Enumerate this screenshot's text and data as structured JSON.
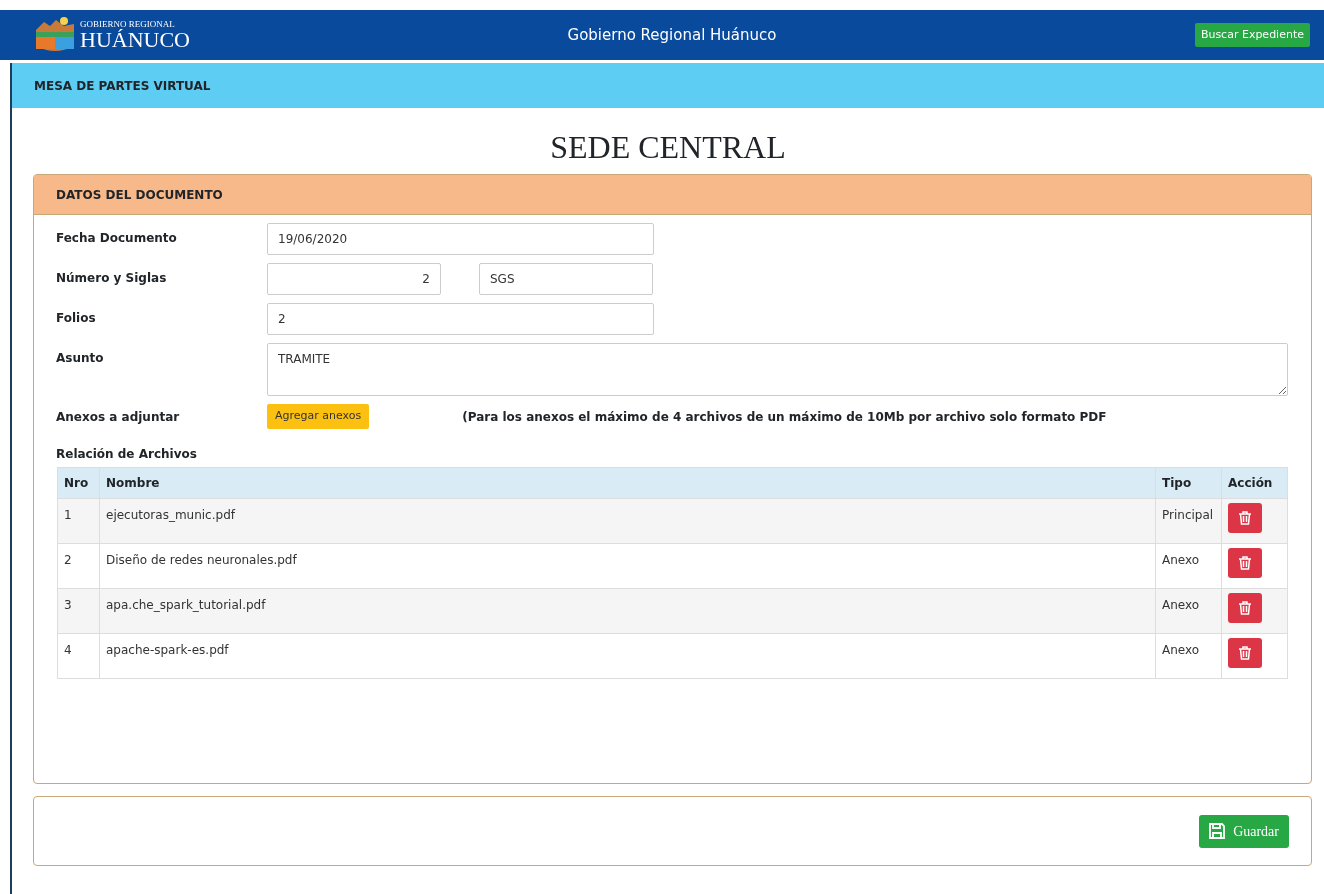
{
  "header": {
    "logo_top": "GOBIERNO REGIONAL",
    "logo_bottom": "HUÁNUCO",
    "title": "Gobierno Regional Huánuco",
    "search_button": "Buscar Expediente"
  },
  "subheader": {
    "title": "MESA DE PARTES VIRTUAL"
  },
  "heading": "SEDE CENTRAL",
  "document_card": {
    "title": "DATOS DEL DOCUMENTO",
    "fields": [
      {
        "label": "Fecha Documento",
        "kind": "text",
        "values": [
          "19/06/2020"
        ]
      },
      {
        "label": "Número y Siglas",
        "kind": "pair",
        "values": [
          "2",
          "SGS"
        ]
      },
      {
        "label": "Folios",
        "kind": "text",
        "values": [
          "2"
        ]
      },
      {
        "label": "Asunto",
        "kind": "textarea",
        "values": [
          "TRAMITE"
        ]
      }
    ],
    "annexes": {
      "label": "Anexos a adjuntar",
      "button": "Agregar anexos",
      "note": "(Para los anexos el máximo de 4 archivos de un máximo de 10Mb por archivo solo formato PDF"
    },
    "files": {
      "title": "Relación de Archivos",
      "columns": [
        "Nro",
        "Nombre",
        "Tipo",
        "Acción"
      ],
      "rows": [
        {
          "nro": "1",
          "name": "ejecutoras_munic.pdf",
          "type": "Principal"
        },
        {
          "nro": "2",
          "name": "Diseño de redes neuronales.pdf",
          "type": "Anexo"
        },
        {
          "nro": "3",
          "name": "apa.che_spark_tutorial.pdf",
          "type": "Anexo"
        },
        {
          "nro": "4",
          "name": "apache-spark-es.pdf",
          "type": "Anexo"
        }
      ]
    }
  },
  "save_button": "Guardar"
}
